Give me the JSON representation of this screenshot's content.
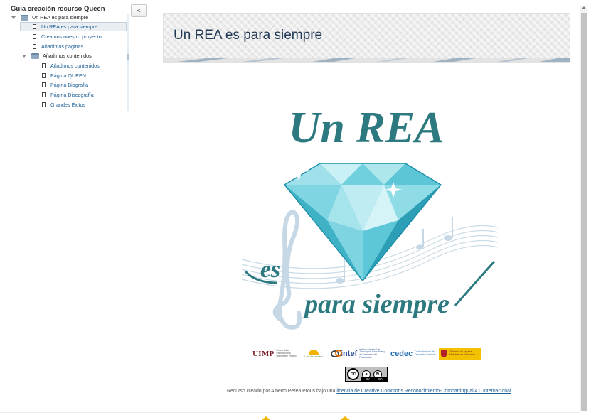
{
  "toc": {
    "title": "Guía creación recurso Queen",
    "collapse_label": "<",
    "items": [
      {
        "label": "Un REA es para siempre",
        "type": "folder"
      },
      {
        "label": "Un REA es para siempre",
        "type": "page",
        "active": true
      },
      {
        "label": "Creamos nuestro proyecto",
        "type": "page"
      },
      {
        "label": "Añadimos páginas",
        "type": "page"
      },
      {
        "label": "Añadimos contenidos",
        "type": "folder"
      },
      {
        "label": "Añadimos contenidos",
        "type": "page"
      },
      {
        "label": "Página QUEEN",
        "type": "page"
      },
      {
        "label": "Página Biografía",
        "type": "page"
      },
      {
        "label": "Página Discografía",
        "type": "page"
      },
      {
        "label": "Grandes Éxitos",
        "type": "page"
      }
    ]
  },
  "header": {
    "title": "Un REA es para siempre"
  },
  "illustration": {
    "top_text": "Un REA",
    "bottom_text_1": "es",
    "bottom_text_2": "para siempre"
  },
  "partners": {
    "uimp": "UIMP",
    "uimp_sub": "Universidad Internacional Menéndez Pelayo",
    "lab": "Lab. de lo sabio",
    "intef": "intef",
    "intef_sub": "Instituto Nacional de Tecnologías Educativas y de Formación del Profesorado",
    "cedec": "cedec",
    "cedec_sub": "Centro Nacional de Desarrollo Curricular",
    "gob_sub": "Gobierno de España Ministerio de Educación"
  },
  "license": {
    "cc_label": "cc",
    "by_label": "BY",
    "sa_label": "SA",
    "credit_prefix": "Recurso creado por Alberto Perea Prous bajo una ",
    "credit_link": "licencia de Creative Commons Reconocimiento-CompartirIgual 4.0 Internacional",
    "credit_suffix": "."
  },
  "colors": {
    "teal": "#2c7a80",
    "diamond_light": "#a9e6ee",
    "diamond_mid": "#4fc3d4",
    "diamond_dark": "#1c8fa8",
    "link": "#1f5f95",
    "header_title": "#233a57"
  }
}
